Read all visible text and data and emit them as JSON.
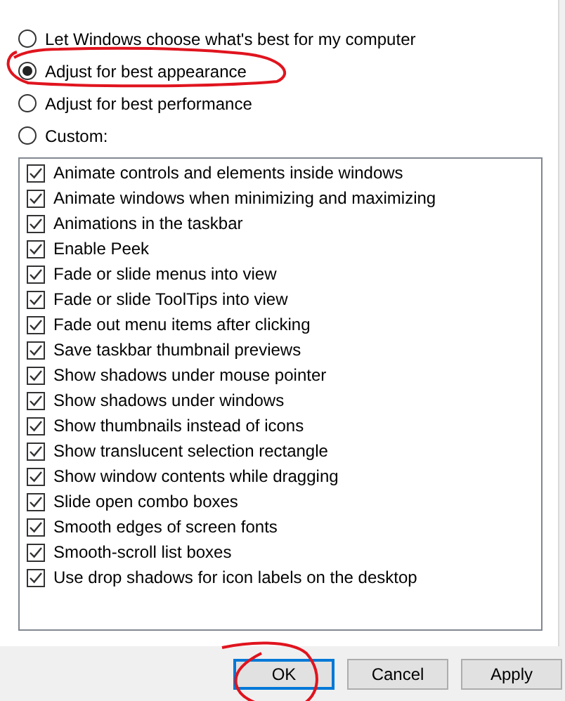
{
  "options": [
    {
      "label": "Let Windows choose what's best for my computer",
      "selected": false
    },
    {
      "label": "Adjust for best appearance",
      "selected": true
    },
    {
      "label": "Adjust for best performance",
      "selected": false
    },
    {
      "label": "Custom:",
      "selected": false
    }
  ],
  "settings": [
    {
      "label": "Animate controls and elements inside windows",
      "checked": true
    },
    {
      "label": "Animate windows when minimizing and maximizing",
      "checked": true
    },
    {
      "label": "Animations in the taskbar",
      "checked": true
    },
    {
      "label": "Enable Peek",
      "checked": true
    },
    {
      "label": "Fade or slide menus into view",
      "checked": true
    },
    {
      "label": "Fade or slide ToolTips into view",
      "checked": true
    },
    {
      "label": "Fade out menu items after clicking",
      "checked": true
    },
    {
      "label": "Save taskbar thumbnail previews",
      "checked": true
    },
    {
      "label": "Show shadows under mouse pointer",
      "checked": true
    },
    {
      "label": "Show shadows under windows",
      "checked": true
    },
    {
      "label": "Show thumbnails instead of icons",
      "checked": true
    },
    {
      "label": "Show translucent selection rectangle",
      "checked": true
    },
    {
      "label": "Show window contents while dragging",
      "checked": true
    },
    {
      "label": "Slide open combo boxes",
      "checked": true
    },
    {
      "label": "Smooth edges of screen fonts",
      "checked": true
    },
    {
      "label": "Smooth-scroll list boxes",
      "checked": true
    },
    {
      "label": "Use drop shadows for icon labels on the desktop",
      "checked": true
    }
  ],
  "buttons": [
    {
      "label": "OK",
      "kind": "default"
    },
    {
      "label": "Cancel",
      "kind": "normal"
    },
    {
      "label": "Apply",
      "kind": "normal"
    }
  ]
}
